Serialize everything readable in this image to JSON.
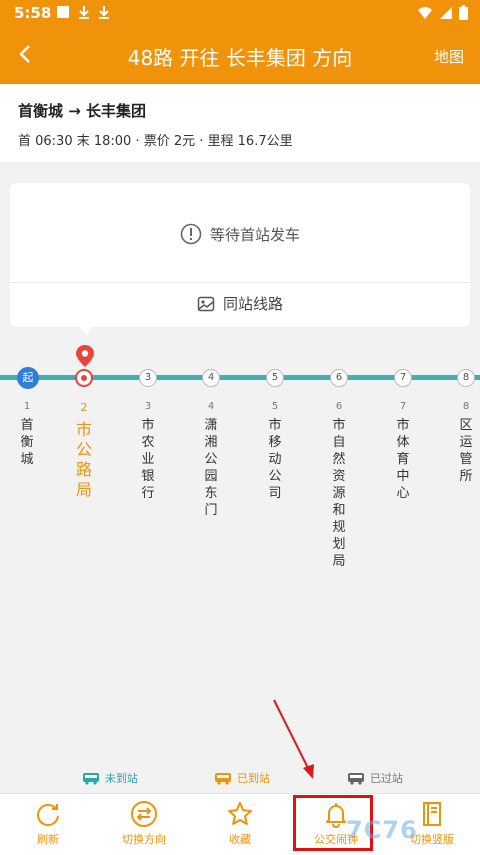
{
  "status_bar": {
    "time": "5:58"
  },
  "app_bar": {
    "title": "48路 开往 长丰集团 方向",
    "map_label": "地图"
  },
  "route_info": {
    "route": "首衡城 → 长丰集团",
    "meta": "首 06:30 末 18:00 · 票价 2元 · 里程 16.7公里"
  },
  "wait_card": {
    "waiting_text": "等待首站发车",
    "same_station_label": "同站线路"
  },
  "stops": [
    {
      "badge": "起",
      "num": "1",
      "name": "首衡城"
    },
    {
      "badge": "",
      "num": "2",
      "name": "市公路局"
    },
    {
      "badge": "3",
      "num": "3",
      "name": "市农业银行"
    },
    {
      "badge": "4",
      "num": "4",
      "name": "潇湘公园东门"
    },
    {
      "badge": "5",
      "num": "5",
      "name": "市移动公司"
    },
    {
      "badge": "6",
      "num": "6",
      "name": "市自然资源和规划局"
    },
    {
      "badge": "7",
      "num": "7",
      "name": "市体育中心"
    },
    {
      "badge": "8",
      "num": "8",
      "name": "区运管所"
    }
  ],
  "legend": {
    "not_arrived": "未到站",
    "arrived": "已到站",
    "passed": "已过站"
  },
  "bottom_nav": {
    "refresh": "刷新",
    "switch_direction": "切换方向",
    "favorite": "收藏",
    "bus_alert": "公交闹钟",
    "switch_vertical": "切换竖版"
  },
  "watermark": "7C76",
  "colors": {
    "accent": "#f0920a",
    "line": "#3fb0b0",
    "current": "#e8453c",
    "first": "#2e7fd8",
    "highlight": "#e01010"
  }
}
